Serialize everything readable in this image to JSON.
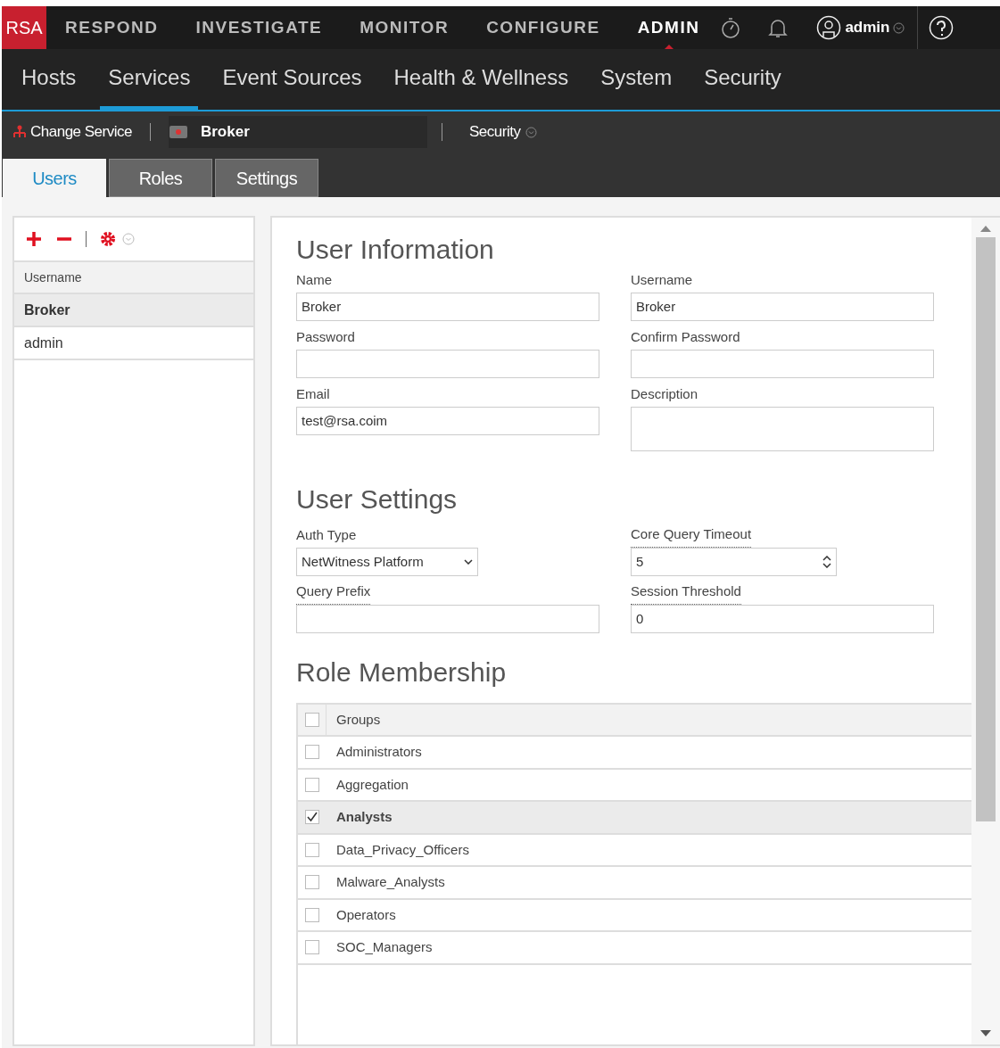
{
  "top_nav": {
    "logo": "RSA",
    "items": [
      {
        "label": "RESPOND",
        "selected": false
      },
      {
        "label": "INVESTIGATE",
        "selected": false
      },
      {
        "label": "MONITOR",
        "selected": false
      },
      {
        "label": "CONFIGURE",
        "selected": false
      },
      {
        "label": "ADMIN",
        "selected": true
      }
    ],
    "user": "admin"
  },
  "admin_nav": [
    {
      "label": "Hosts",
      "selected": false
    },
    {
      "label": "Services",
      "selected": true
    },
    {
      "label": "Event Sources",
      "selected": false
    },
    {
      "label": "Health & Wellness",
      "selected": false
    },
    {
      "label": "System",
      "selected": false
    },
    {
      "label": "Security",
      "selected": false
    }
  ],
  "service_bar": {
    "change_service": "Change Service",
    "service": "Broker",
    "view": "Security"
  },
  "tabs": [
    {
      "label": "Users",
      "selected": true
    },
    {
      "label": "Roles",
      "selected": false
    },
    {
      "label": "Settings",
      "selected": false
    }
  ],
  "users_list": {
    "column": "Username",
    "rows": [
      {
        "name": "Broker",
        "selected": true
      },
      {
        "name": "admin",
        "selected": false
      }
    ]
  },
  "user_information": {
    "title": "User Information",
    "fields": [
      {
        "label": "Name",
        "value": "Broker",
        "kind": "text"
      },
      {
        "label": "Username",
        "value": "Broker",
        "kind": "text"
      },
      {
        "label": "Password",
        "kind": "text"
      },
      {
        "label": "Confirm Password",
        "kind": "text"
      },
      {
        "label": "Email",
        "value": "test@rsa.coim",
        "kind": "text"
      },
      {
        "label": "Description",
        "kind": "textarea"
      }
    ]
  },
  "user_settings": {
    "title": "User Settings",
    "fields": [
      {
        "label": "Auth Type",
        "value": "NetWitness Platform",
        "kind": "select",
        "tooltip": false
      },
      {
        "label": "Core Query Timeout",
        "value": "5",
        "kind": "spinner",
        "tooltip": true
      },
      {
        "label": "Query Prefix",
        "kind": "text",
        "tooltip": true
      },
      {
        "label": "Session Threshold",
        "value": "0",
        "kind": "text",
        "tooltip": true
      }
    ]
  },
  "role_membership": {
    "title": "Role Membership",
    "column": "Groups",
    "all_checked": false,
    "groups": [
      {
        "name": "Administrators",
        "checked": false,
        "selected": false
      },
      {
        "name": "Aggregation",
        "checked": false,
        "selected": false
      },
      {
        "name": "Analysts",
        "checked": true,
        "selected": true
      },
      {
        "name": "Data_Privacy_Officers",
        "checked": false,
        "selected": false
      },
      {
        "name": "Malware_Analysts",
        "checked": false,
        "selected": false
      },
      {
        "name": "Operators",
        "checked": false,
        "selected": false
      },
      {
        "name": "SOC_Managers",
        "checked": false,
        "selected": false
      }
    ]
  }
}
